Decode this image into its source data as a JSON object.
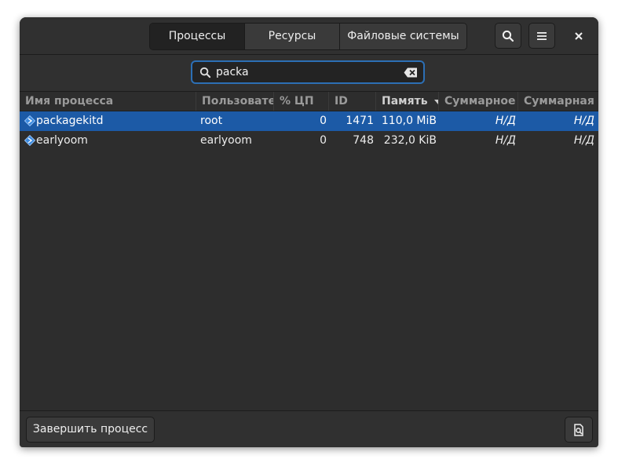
{
  "tabs": [
    {
      "label": "Процессы",
      "active": true
    },
    {
      "label": "Ресурсы",
      "active": false
    },
    {
      "label": "Файловые системы",
      "active": false
    }
  ],
  "header_buttons": {
    "search_icon": "search-icon",
    "menu_icon": "hamburger-menu-icon",
    "close_icon": "close-icon"
  },
  "search": {
    "value": "packa",
    "search_icon": "search-icon",
    "clear_icon": "clear-text-icon"
  },
  "columns": [
    {
      "label": "Имя процесса"
    },
    {
      "label": "Пользовател"
    },
    {
      "label": "% ЦП"
    },
    {
      "label": "ID"
    },
    {
      "label": "Память",
      "sorted": "descending",
      "sort_icon": "sort-down-icon"
    },
    {
      "label": "Суммарное чтение"
    },
    {
      "label": "Суммарная запись"
    }
  ],
  "rows": [
    {
      "name": "packagekitd",
      "user": "root",
      "cpu": "0",
      "id": "1471",
      "memory": "110,0 MiB",
      "disk_read": "Н/Д",
      "disk_write": "Н/Д",
      "selected": true,
      "icon": "process-icon"
    },
    {
      "name": "earlyoom",
      "user": "earlyoom",
      "cpu": "0",
      "id": "748",
      "memory": "232,0 KiB",
      "disk_read": "Н/Д",
      "disk_write": "Н/Д",
      "selected": false,
      "icon": "process-icon"
    }
  ],
  "footer": {
    "end_process_label": "Завершить процесс",
    "properties_icon": "process-properties-icon"
  },
  "colors": {
    "selection": "#1c5aa6",
    "search_focus": "#2c6fb5",
    "window_bg": "#2d2d2d"
  }
}
